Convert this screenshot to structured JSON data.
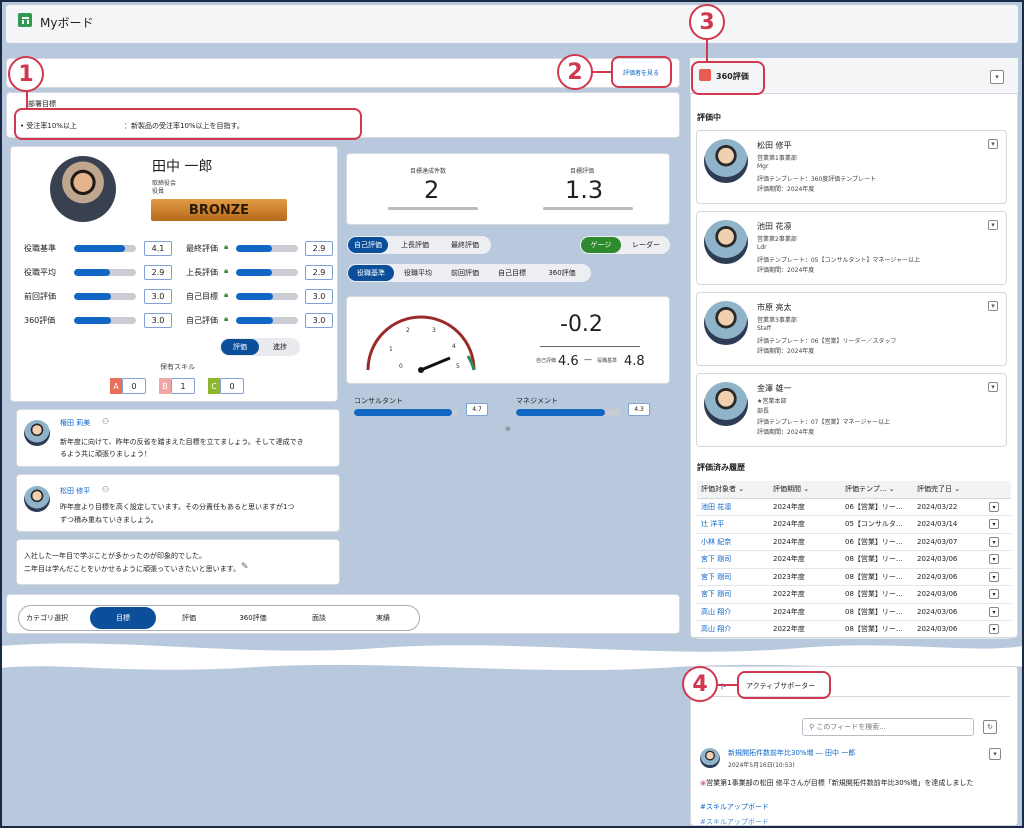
{
  "header": {
    "title": "Myボード"
  },
  "annotations": {
    "n1": "1",
    "n2": "2",
    "n3": "3",
    "n4": "4"
  },
  "dept_goal": {
    "heading": "部署目標",
    "bullet": "受注率10%以上",
    "detail": "：新製品の受注率10%以上を目指す。"
  },
  "view_evaluator_label": "評価者を見る",
  "profile": {
    "name": "田中 一郎",
    "role1": "取締役会",
    "role2": "役員",
    "rank": "BRONZE"
  },
  "metrics_left": [
    {
      "label": "役職基準",
      "value": "4.1",
      "fill": 0.82
    },
    {
      "label": "役職平均",
      "value": "2.9",
      "fill": 0.58
    },
    {
      "label": "前回評価",
      "value": "3.0",
      "fill": 0.6
    },
    {
      "label": "360評価",
      "value": "3.0",
      "fill": 0.6
    }
  ],
  "metrics_right": [
    {
      "label": "最終評価",
      "value": "2.9",
      "fill": 0.58
    },
    {
      "label": "上長評価",
      "value": "2.9",
      "fill": 0.58
    },
    {
      "label": "自己目標",
      "value": "3.0",
      "fill": 0.6
    },
    {
      "label": "自己評価",
      "value": "3.0",
      "fill": 0.6
    }
  ],
  "toggle": {
    "on": "評価",
    "off": "進捗"
  },
  "skills": {
    "title": "保有スキル",
    "a_label": "A",
    "a": "0",
    "b_label": "B",
    "b": "1",
    "c_label": "C",
    "c": "0"
  },
  "stats": {
    "achieved_label": "目標達成件数",
    "achieved": "2",
    "goal_eval_label": "目標評価",
    "goal_eval": "1.3"
  },
  "eval_tabs": [
    "自己評価",
    "上長評価",
    "最終評価"
  ],
  "view_tabs": [
    "ゲージ",
    "レーダー"
  ],
  "compare_tabs": [
    "役職基準",
    "役職平均",
    "前回評価",
    "自己目標",
    "360評価"
  ],
  "gauge": {
    "diff": "-0.2",
    "self_label": "自己評価",
    "self": "4.6",
    "std_label": "役職基準",
    "std": "4.8",
    "ticks": [
      "1",
      "2",
      "3",
      "4",
      "5",
      "0"
    ]
  },
  "categories": [
    {
      "label": "コンサルタント",
      "value": "4.7",
      "fill": 0.94
    },
    {
      "label": "マネジメント",
      "value": "4.3",
      "fill": 0.86
    }
  ],
  "comments": [
    {
      "name": "権田 莉美",
      "text1": "新年度に向けて、昨年の反省を踏まえた目標を立てましょう。そして達成でき",
      "text2": "るよう共に頑張りましょう！"
    },
    {
      "name": "松田 修平",
      "text1": "昨年度より目標を高く設定しています。その分責任もあると思いますが1つ",
      "text2": "ずつ積み重ねていきましょう。"
    }
  ],
  "self_note": {
    "line1": "入社した一年目で学ぶことが多かったのが印象的でした。",
    "line2": "二年目は学んだことをいかせるように頑張っていきたいと思います。"
  },
  "category_select": {
    "label": "カテゴリ選択",
    "tabs": [
      "目標",
      "評価",
      "360評価",
      "面談",
      "実績"
    ]
  },
  "eval360": {
    "title": "360評価",
    "in_progress": "評価中",
    "people": [
      {
        "name": "松田 修平",
        "dept": "営業第1事業部",
        "title": "Mgr",
        "template": "評価テンプレート：360度評価テンプレート",
        "period": "評価期間：2024年度"
      },
      {
        "name": "池田 花凛",
        "dept": "営業第2事業部",
        "title": "Ldr",
        "template": "評価テンプレート：05【コンサルタント】マネージャー以上",
        "period": "評価期間：2024年度"
      },
      {
        "name": "市原 亮太",
        "dept": "営業第3事業部",
        "title": "Staff",
        "template": "評価テンプレート：06【営業】リーダー／スタッフ",
        "period": "評価期間：2024年度"
      },
      {
        "name": "金澤 雄一",
        "dept": "★営業本部",
        "title": "部長",
        "template": "評価テンプレート：07【営業】マネージャー以上",
        "period": "評価期間：2024年度"
      }
    ],
    "done_title": "評価済み履歴",
    "columns": [
      "評価対象者",
      "評価期間",
      "評価テンプ...",
      "評価完了日"
    ],
    "rows": [
      [
        "池田 花凛",
        "2024年度",
        "06【営業】リー...",
        "2024/03/22"
      ],
      [
        "辻 洋平",
        "2024年度",
        "05【コンサルタ...",
        "2024/03/14"
      ],
      [
        "小林 紀奈",
        "2024年度",
        "06【営業】リー...",
        "2024/03/07"
      ],
      [
        "宮下 剛司",
        "2024年度",
        "08【営業】リー...",
        "2024/03/06"
      ],
      [
        "宮下 剛司",
        "2023年度",
        "08【営業】リー...",
        "2024/03/06"
      ],
      [
        "宮下 剛司",
        "2022年度",
        "08【営業】リー...",
        "2024/03/06"
      ],
      [
        "高山 翔介",
        "2024年度",
        "08【営業】リー...",
        "2024/03/06"
      ],
      [
        "高山 翔介",
        "2022年度",
        "08【営業】リー...",
        "2024/03/06"
      ]
    ]
  },
  "feed": {
    "tab_partial": "ト",
    "active_label": "アクティブサポーター",
    "search_placeholder": "このフィードを検索...",
    "post_title": "新規開拓件数前年比30%増 ― 田中 一郎",
    "post_date": "2024年5月16日(10:53)",
    "post_body": "営業第1事業部の松田 修平さんが目標「新規開拓件数前年比30%増」を達成しました",
    "hashtag": "#スキルアップボード",
    "hashtag2": "#スキルアップボード"
  }
}
